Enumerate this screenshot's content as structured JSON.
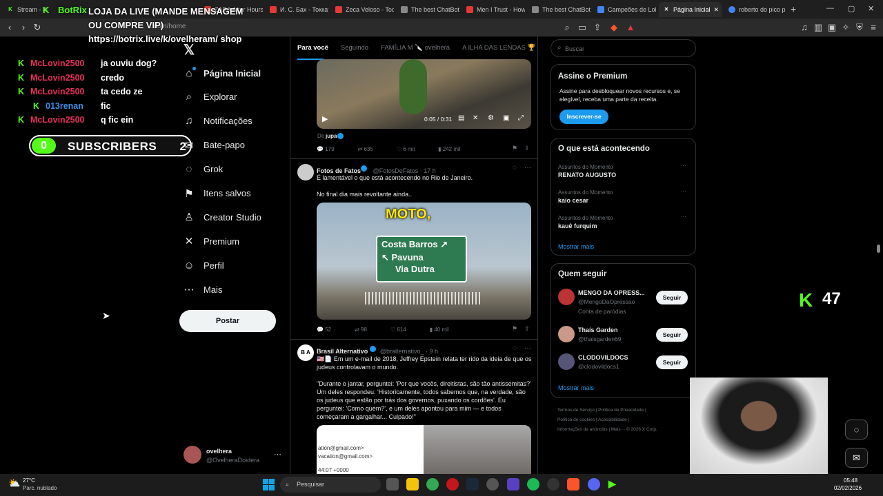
{
  "browser": {
    "tabs": [
      {
        "label": "Stream - K",
        "color": "#53fc18"
      },
      {
        "label": "BotRix",
        "color": "#53fc18"
      },
      {
        "label": "ZARA After Hours",
        "color": "#e53935"
      },
      {
        "label": "И. С. Бах - Токката",
        "color": "#e53935"
      },
      {
        "label": "Zeca Veloso - Todo",
        "color": "#e53935"
      },
      {
        "label": "The best ChatBot",
        "color": "#888888"
      },
      {
        "label": "Men I Trust - How",
        "color": "#e53935"
      },
      {
        "label": "The best ChatBot",
        "color": "#888888"
      },
      {
        "label": "Campeões de LoL",
        "color": "#4285f4"
      },
      {
        "label": "Página Inicial",
        "color": "#ffffff"
      },
      {
        "label": "roberto do pico p",
        "color": "#4285f4"
      }
    ],
    "url": "x.com/home",
    "new_tab": "+"
  },
  "stream_overlay": {
    "botrix_message": "LOJA DA LIVE (MANDE MENSAGEM OU COMPRE VIP) https://botrix.live/k/ovelheram/ shop",
    "botrix_user": "BotRix",
    "chat": [
      {
        "user": "McLovin2500",
        "message": "ja ouviu dog?",
        "color": "#e8305a"
      },
      {
        "user": "McLovin2500",
        "message": "credo",
        "color": "#e8305a"
      },
      {
        "user": "McLovin2500",
        "message": "ta cedo ze",
        "color": "#e8305a"
      },
      {
        "user": "013renan",
        "message": "fic",
        "color": "#3b8fe8"
      },
      {
        "user": "McLovin2500",
        "message": "q fic ein",
        "color": "#e8305a"
      }
    ],
    "subscribers": {
      "current": "0",
      "label": "SUBSCRIBERS",
      "goal": "2"
    },
    "kick_viewers": "47"
  },
  "x_nav": {
    "items": [
      {
        "label": "Página Inicial",
        "icon": "home-icon",
        "glyph": "⌂"
      },
      {
        "label": "Explorar",
        "icon": "search-icon",
        "glyph": "⌕"
      },
      {
        "label": "Notificações",
        "icon": "bell-icon",
        "glyph": "♫"
      },
      {
        "label": "Bate-papo",
        "icon": "chat-icon",
        "glyph": "✉"
      },
      {
        "label": "Grok",
        "icon": "grok-icon",
        "glyph": "◌"
      },
      {
        "label": "Itens salvos",
        "icon": "bookmark-icon",
        "glyph": "⚑"
      },
      {
        "label": "Creator Studio",
        "icon": "creator-icon",
        "glyph": "♙"
      },
      {
        "label": "Premium",
        "icon": "x-logo-icon",
        "glyph": "✕"
      },
      {
        "label": "Perfil",
        "icon": "person-icon",
        "glyph": "☺"
      },
      {
        "label": "Mais",
        "icon": "more-icon",
        "glyph": "⋯"
      }
    ],
    "post_button": "Postar",
    "account": {
      "name": "ovelhera",
      "handle": "@OvelheraDoidera",
      "more": "···"
    }
  },
  "feed": {
    "tabs": [
      "Para você",
      "Seguindo",
      "FAMÍLIA M 🔪 ovelhera",
      "A ILHA DAS LENDAS 🏆"
    ],
    "tweet1": {
      "video_time": "0:05 / 0:31",
      "from_label": "De",
      "from_user": "jupa",
      "replies": "179",
      "reposts": "635",
      "likes": "6 mil",
      "views": "242 mil"
    },
    "tweet2": {
      "name": "Fotos de Fatos",
      "handle": "@FotosDeFatos · 17 h",
      "text1": "É lamentável o que está acontecendo no Rio de Janeiro.",
      "text2": "No final dia mais revoltante ainda..",
      "caption": "MOTO,",
      "sign_line1": "Costa Barros ↗",
      "sign_line2": "↖ Pavuna",
      "sign_line3": "Via Dutra",
      "replies": "52",
      "reposts": "98",
      "likes": "614",
      "views": "40 mil"
    },
    "tweet3": {
      "name": "Brasil Alternativo",
      "handle": "@bralternativo_ · 9 h",
      "text1": "🇺🇸📄 Em um e-mail de 2018, Jeffrey Epstein relata ter rido da ideia de que os judeus controlavam o mundo.",
      "text2": "\"Durante o jantar, perguntei: 'Por que vocês, direitistas, são tão antissemitas?' Um deles respondeu: 'Historicamente, todos sabemos que, na verdade, são os judeus que estão por trás dos governos, puxando os cordões'. Eu perguntei: 'Como quem?', e um deles apontou para mim — e todos começaram a gargalhar... Culpado!\"",
      "email1": "ation@gmail.com>",
      "email2": "vacation@gmail.com>",
      "email3": "44:07 +0000"
    }
  },
  "sidebar": {
    "search_placeholder": "Buscar",
    "premium": {
      "title": "Assine o Premium",
      "text": "Assine para desbloquear novos recursos e, se elegível, receba uma parte da receita.",
      "button": "Inscrever-se"
    },
    "trends": {
      "title": "O que está acontecendo",
      "items": [
        {
          "category": "Assuntos do Momento",
          "name": "RENATO AUGUSTO"
        },
        {
          "category": "Assuntos do Momento",
          "name": "kaio cesar"
        },
        {
          "category": "Assuntos do Momento",
          "name": "kauê furquim"
        }
      ],
      "more": "Mostrar mais"
    },
    "who_to_follow": {
      "title": "Quem seguir",
      "users": [
        {
          "name": "MENGO DA OPRESS...",
          "handle": "@MengoDaOpressao",
          "note": "Conta de paródias",
          "button": "Seguir"
        },
        {
          "name": "Thaís Garden",
          "handle": "@thaisgarden69",
          "note": "",
          "button": "Seguir"
        },
        {
          "name": "CLODOVILDOCS",
          "handle": "@clodovildocs1",
          "note": "",
          "button": "Seguir"
        }
      ],
      "more": "Mostrar mais"
    },
    "footer": {
      "line1": "Termos de Serviço  |  Política de Privacidade  |",
      "line2": "Política de cookies  |  Acessibilidade  |",
      "line3": "Informações de anúncios  |  Mais···  © 2026 X Corp."
    }
  },
  "taskbar": {
    "weather_temp": "27°C",
    "weather_desc": "Parc. nublado",
    "search": "Pesquisar",
    "time": "05:48",
    "date": "02/02/2026"
  }
}
